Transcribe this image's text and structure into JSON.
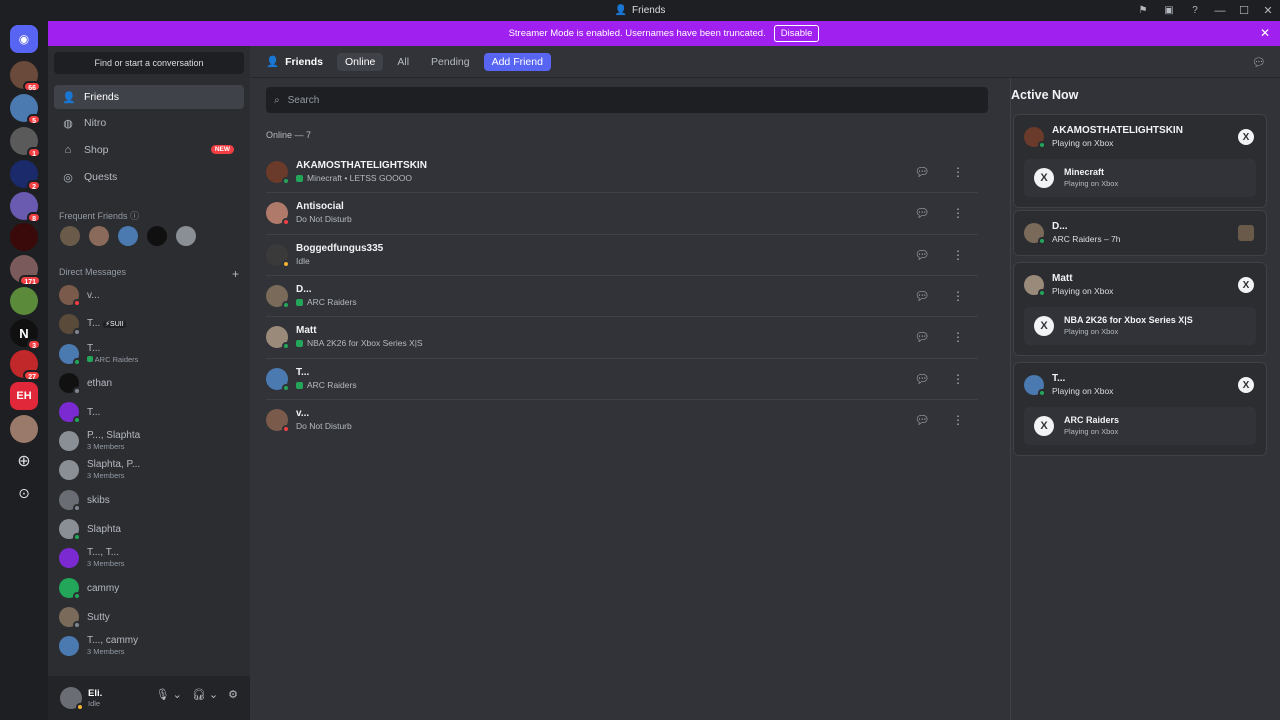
{
  "titlebar": {
    "title": "Friends"
  },
  "banner": {
    "text": "Streamer Mode is enabled. Usernames have been truncated.",
    "button": "Disable"
  },
  "server_badges": [
    "66",
    "5",
    "1",
    "2",
    "8",
    "171",
    "3",
    "27"
  ],
  "sidebar": {
    "find_placeholder": "Find or start a conversation",
    "nav": [
      {
        "label": "Friends",
        "icon": "friends-icon"
      },
      {
        "label": "Nitro",
        "icon": "nitro-icon"
      },
      {
        "label": "Shop",
        "icon": "shop-icon",
        "badge": "NEW"
      },
      {
        "label": "Quests",
        "icon": "quests-icon"
      }
    ],
    "frequent_friends_label": "Frequent Friends",
    "direct_messages_label": "Direct Messages",
    "dms": [
      {
        "name": "v...",
        "sub": "",
        "status": "dnd",
        "color": "#7a5a4a"
      },
      {
        "name": "T...",
        "tag": "⚡SUII",
        "sub": "",
        "status": "off",
        "color": "#5a4a3a"
      },
      {
        "name": "T...",
        "sub": "ARC Raiders",
        "status": "on",
        "color": "#4a7ab0"
      },
      {
        "name": "ethan",
        "sub": "",
        "status": "off",
        "color": "#111111"
      },
      {
        "name": "T...",
        "sub": "",
        "status": "on",
        "color": "#7a2ad0"
      },
      {
        "name": "P..., Slaphta",
        "sub": "3 Members",
        "status": "",
        "color": "#8a8f96"
      },
      {
        "name": "Slaphta, P...",
        "sub": "3 Members",
        "status": "",
        "color": "#8a8f96"
      },
      {
        "name": "skibs",
        "sub": "",
        "status": "off",
        "color": "#6a6e74"
      },
      {
        "name": "Slaphta",
        "sub": "",
        "status": "on",
        "color": "#8a8f96"
      },
      {
        "name": "T..., T...",
        "sub": "3 Members",
        "status": "",
        "color": "#7a2ad0"
      },
      {
        "name": "cammy",
        "sub": "",
        "status": "on",
        "color": "#23a55a"
      },
      {
        "name": "Sutty",
        "sub": "",
        "status": "off",
        "color": "#7a6a5a"
      },
      {
        "name": "T..., cammy",
        "sub": "3 Members",
        "status": "",
        "color": "#4a7ab0"
      }
    ]
  },
  "user": {
    "name": "Eli.",
    "status": "Idle"
  },
  "topbar": {
    "title": "Friends",
    "tabs": [
      "Online",
      "All",
      "Pending"
    ],
    "add_friend": "Add Friend"
  },
  "search": {
    "placeholder": "Search"
  },
  "online_header": "Online — 7",
  "friends": [
    {
      "name": "AKAMOSTHATELIGHTSKIN",
      "status_text": "Minecraft • LETSS GOOOO",
      "playing": true,
      "status": "on",
      "color": "#6a3a2a"
    },
    {
      "name": "Antisocial",
      "status_text": "Do Not Disturb",
      "playing": false,
      "status": "dnd",
      "color": "#b07a6a"
    },
    {
      "name": "Boggedfungus335",
      "status_text": "Idle",
      "playing": false,
      "status": "idle",
      "color": "#3a3a3a"
    },
    {
      "name": "D...",
      "status_text": "ARC Raiders",
      "playing": true,
      "status": "on",
      "color": "#7a6a5a"
    },
    {
      "name": "Matt",
      "status_text": "NBA 2K26 for Xbox Series X|S",
      "playing": true,
      "status": "on",
      "color": "#9a8a7a"
    },
    {
      "name": "T...",
      "status_text": "ARC Raiders",
      "playing": true,
      "status": "on",
      "color": "#4a7ab0"
    },
    {
      "name": "v...",
      "status_text": "Do Not Disturb",
      "playing": false,
      "status": "dnd",
      "color": "#7a5a4a"
    }
  ],
  "active_now": {
    "title": "Active Now",
    "cards": [
      {
        "name": "AKAMOSTHATELIGHTSKIN",
        "sub": "Playing on Xbox",
        "game": "Minecraft",
        "game_sub": "Playing on Xbox",
        "color": "#6a3a2a"
      },
      {
        "name": "D...",
        "sub": "ARC Raiders – 7h",
        "game": "",
        "game_sub": "",
        "color": "#7a6a5a"
      },
      {
        "name": "Matt",
        "sub": "Playing on Xbox",
        "game": "NBA 2K26 for Xbox Series X|S",
        "game_sub": "Playing on Xbox",
        "color": "#9a8a7a"
      },
      {
        "name": "T...",
        "sub": "Playing on Xbox",
        "game": "ARC Raiders",
        "game_sub": "Playing on Xbox",
        "color": "#4a7ab0"
      }
    ]
  }
}
